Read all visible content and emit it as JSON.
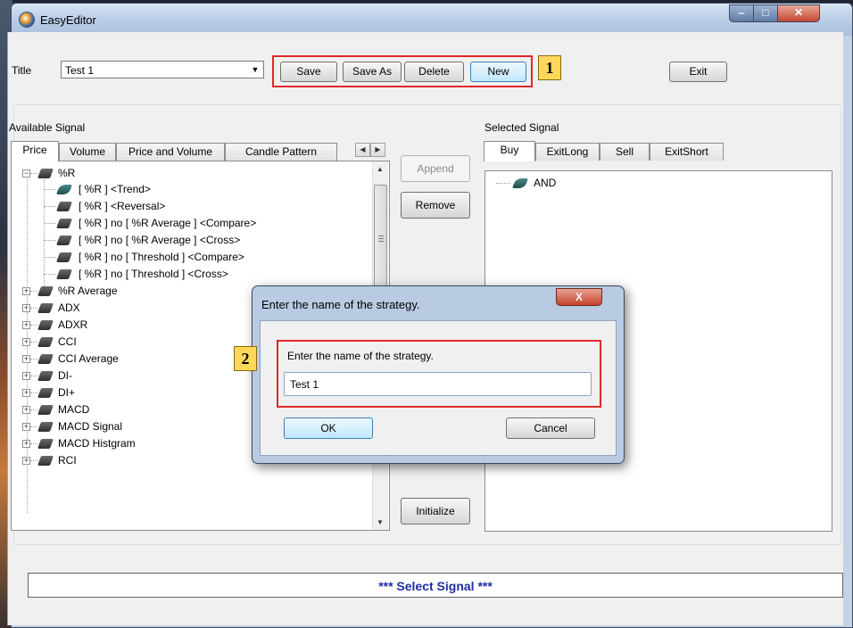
{
  "window": {
    "title": "EasyEditor",
    "minimize": "‒",
    "maximize": "□",
    "close": "✕"
  },
  "toolbar": {
    "title_label": "Title",
    "title_value": "Test 1",
    "save": "Save",
    "save_as": "Save As",
    "delete": "Delete",
    "new": "New",
    "exit": "Exit",
    "badge1": "1"
  },
  "available": {
    "label": "Available Signal",
    "tabs": [
      "Price",
      "Volume",
      "Price and Volume",
      "Candle Pattern"
    ],
    "tree": {
      "root": "%R",
      "children": [
        "[ %R ] <Trend>",
        "[ %R ] <Reversal>",
        "[ %R ] no [ %R Average ] <Compare>",
        "[ %R ] no [ %R Average ] <Cross>",
        "[ %R ] no [ Threshold ] <Compare>",
        "[ %R ] no [ Threshold ] <Cross>"
      ],
      "others": [
        "%R Average",
        "ADX",
        "ADXR",
        "CCI",
        "CCI Average",
        "DI-",
        "DI+",
        "MACD",
        "MACD Signal",
        "MACD Histgram",
        "RCI"
      ]
    }
  },
  "middle": {
    "append": "Append",
    "remove": "Remove",
    "initialize": "Initialize"
  },
  "selected": {
    "label": "Selected Signal",
    "tabs": [
      "Buy",
      "ExitLong",
      "Sell",
      "ExitShort"
    ],
    "tree": [
      "AND"
    ]
  },
  "status": "*** Select Signal ***",
  "dialog": {
    "title": "Enter the name of the strategy.",
    "prompt": "Enter the name of the strategy.",
    "value": "Test 1",
    "ok": "OK",
    "cancel": "Cancel",
    "badge2": "2"
  },
  "colors": {
    "highlight": "#e0282a",
    "badge": "#ffd85a",
    "status_text": "#1d2ea5"
  }
}
